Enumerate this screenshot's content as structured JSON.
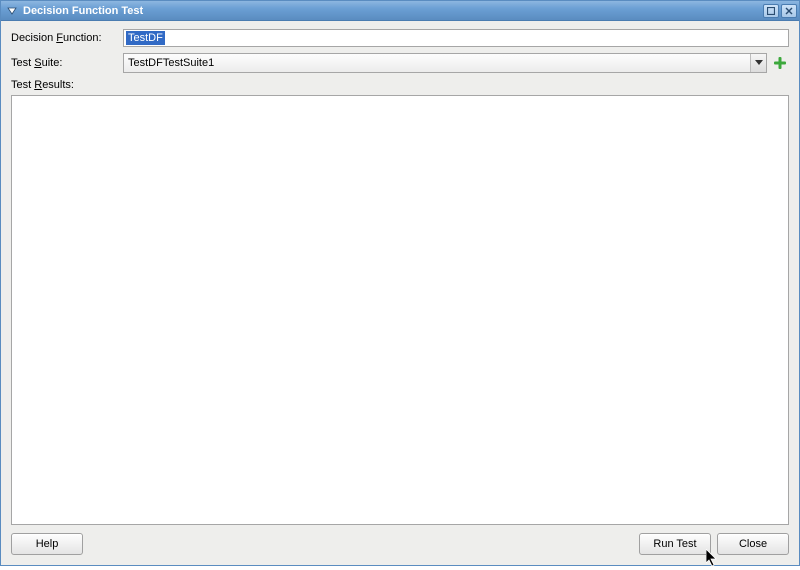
{
  "window": {
    "title": "Decision Function Test"
  },
  "form": {
    "decision_function_label_pre": "Decision ",
    "decision_function_mnemonic": "F",
    "decision_function_label_post": "unction:",
    "decision_function_value": "TestDF",
    "test_suite_label_pre": "Test ",
    "test_suite_mnemonic": "S",
    "test_suite_label_post": "uite:",
    "test_suite_value": "TestDFTestSuite1",
    "test_results_label_pre": "Test ",
    "test_results_mnemonic": "R",
    "test_results_label_post": "esults:"
  },
  "buttons": {
    "help": "Help",
    "run_test": "Run Test",
    "close": "Close"
  }
}
